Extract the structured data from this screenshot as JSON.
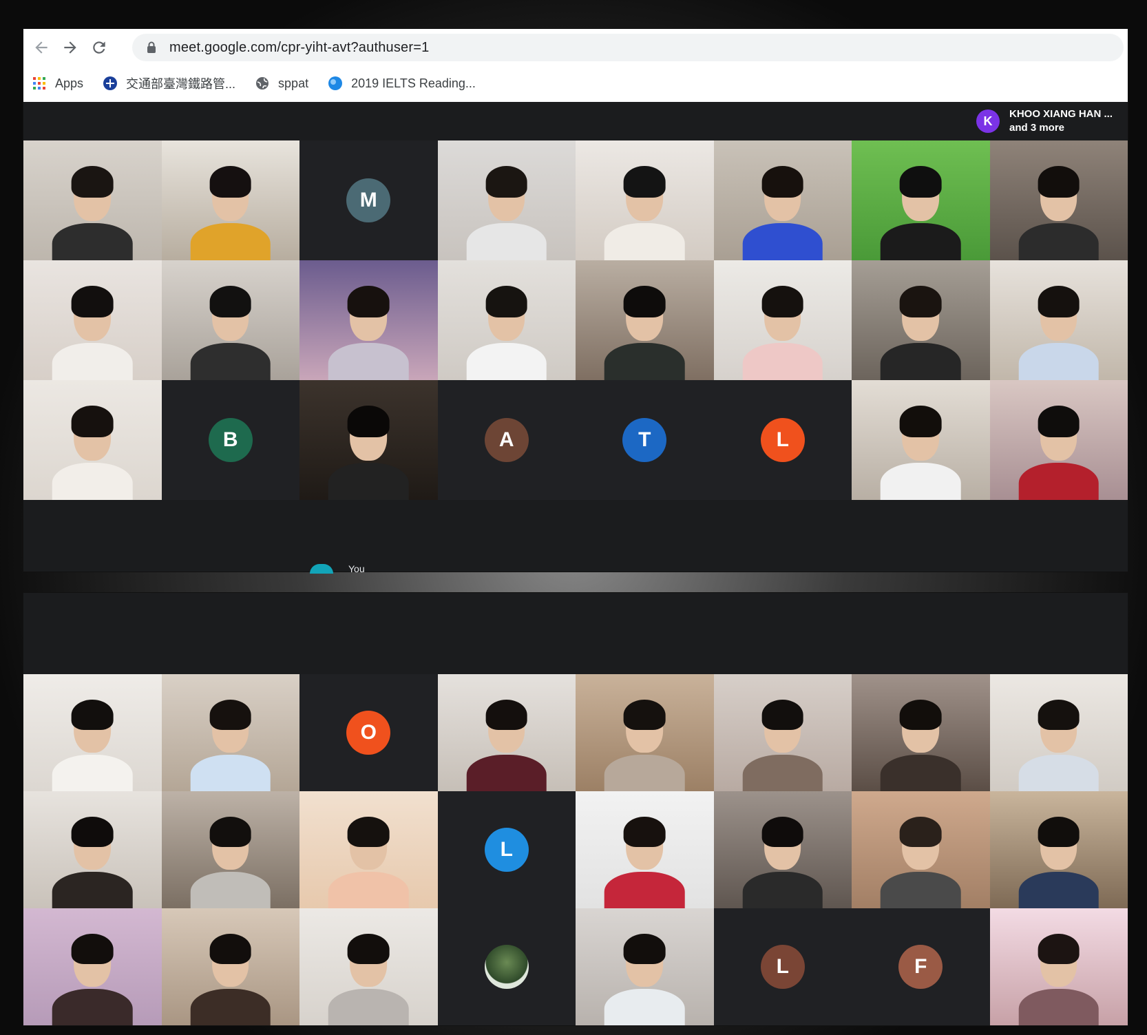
{
  "browser": {
    "url": "meet.google.com/cpr-yiht-avt?authuser=1",
    "bookmarks": [
      {
        "label": "Apps",
        "icon": "apps-grid-icon"
      },
      {
        "label": "交通部臺灣鐵路管...",
        "icon": "railway-logo-icon"
      },
      {
        "label": "sppat",
        "icon": "globe-icon"
      },
      {
        "label": "2019 IELTS Reading...",
        "icon": "ielts-logo-icon"
      }
    ]
  },
  "presenter": {
    "initial": "K",
    "name": "KHOO XIANG HAN ...",
    "more": "and 3 more",
    "color": "#7b33e6"
  },
  "self_label": "You",
  "top_grid": [
    {
      "type": "video",
      "bg": "#d8d3cc",
      "bg2": "#bdb6ad",
      "shirt": "#2d2d2d",
      "hair": "#1a1512"
    },
    {
      "type": "video",
      "bg": "#e8e4dd",
      "bg2": "#b7ad9f",
      "shirt": "#e0a32a",
      "hair": "#151010"
    },
    {
      "type": "avatar",
      "initial": "M",
      "color": "#4b6a74"
    },
    {
      "type": "video",
      "bg": "#dcdad8",
      "bg2": "#c8c3be",
      "shirt": "#e6e6e6",
      "hair": "#1b1612"
    },
    {
      "type": "video",
      "bg": "#ece8e4",
      "bg2": "#d3cbc3",
      "shirt": "#f0ece6",
      "hair": "#141414"
    },
    {
      "type": "video",
      "bg": "#c9c2b8",
      "bg2": "#a99f93",
      "shirt": "#2f4fd0",
      "hair": "#17110d"
    },
    {
      "type": "video",
      "bg": "#6fbf52",
      "bg2": "#4a9a38",
      "shirt": "#1b1b1b",
      "hair": "#0f0f0f"
    },
    {
      "type": "video",
      "bg": "#8f8379",
      "bg2": "#5b524b",
      "shirt": "#2c2c2c",
      "hair": "#120e0c"
    },
    {
      "type": "video",
      "bg": "#e9e4e0",
      "bg2": "#d7cfc8",
      "shirt": "#f1eeea",
      "hair": "#120f0e"
    },
    {
      "type": "video",
      "bg": "#d7d2cc",
      "bg2": "#a9a29a",
      "shirt": "#2e2e2e",
      "hair": "#121110"
    },
    {
      "type": "video",
      "bg": "#6b5c8e",
      "bg2": "#c9a6b9",
      "shirt": "#c7c1cf",
      "hair": "#17110e"
    },
    {
      "type": "video",
      "bg": "#e3e0dc",
      "bg2": "#cfcac4",
      "shirt": "#f3f3f3",
      "hair": "#161310"
    },
    {
      "type": "video",
      "bg": "#b9aea2",
      "bg2": "#7f6f62",
      "shirt": "#2a2f2c",
      "hair": "#0e0c0b"
    },
    {
      "type": "video",
      "bg": "#eceae6",
      "bg2": "#d6d1cc",
      "shirt": "#eec8c6",
      "hair": "#15110e"
    },
    {
      "type": "video",
      "bg": "#a59e95",
      "bg2": "#6c645c",
      "shirt": "#262626",
      "hair": "#1a1410"
    },
    {
      "type": "video",
      "bg": "#e7e2dc",
      "bg2": "#c1b7aa",
      "shirt": "#c9d7ea",
      "hair": "#15110e"
    },
    {
      "type": "video",
      "bg": "#ece8e3",
      "bg2": "#dcd6cf",
      "shirt": "#f2eee9",
      "hair": "#16110e"
    },
    {
      "type": "avatar",
      "initial": "B",
      "color": "#1e6a4e"
    },
    {
      "type": "video",
      "bg": "#3c332c",
      "bg2": "#1f1a16",
      "shirt": "#222",
      "hair": "#0a0807"
    },
    {
      "type": "avatar",
      "initial": "A",
      "color": "#6d4535"
    },
    {
      "type": "avatar",
      "initial": "T",
      "color": "#1c68c4"
    },
    {
      "type": "avatar",
      "initial": "L",
      "color": "#f0511d"
    },
    {
      "type": "video",
      "bg": "#e3ddd5",
      "bg2": "#b8afa4",
      "shirt": "#f1f1f1",
      "hair": "#120e0b"
    },
    {
      "type": "video",
      "bg": "#d9c7c3",
      "bg2": "#a88f93",
      "shirt": "#b4202c",
      "hair": "#0f0d0c"
    }
  ],
  "bottom_grid": [
    {
      "type": "video",
      "bg": "#efece8",
      "bg2": "#dcd7d1",
      "shirt": "#f4f2ee",
      "hair": "#120f0d"
    },
    {
      "type": "video",
      "bg": "#d9d0c6",
      "bg2": "#b4a696",
      "shirt": "#cfe0f2",
      "hair": "#16110e"
    },
    {
      "type": "avatar",
      "initial": "O",
      "color": "#f0511d"
    },
    {
      "type": "video",
      "bg": "#e5e1dd",
      "bg2": "#c6bfb7",
      "shirt": "#5a1e28",
      "hair": "#140f0d"
    },
    {
      "type": "video",
      "bg": "#c9b29a",
      "bg2": "#9c8065",
      "shirt": "#b7a89a",
      "hair": "#15110e"
    },
    {
      "type": "video",
      "bg": "#d7cfc9",
      "bg2": "#b8aaa2",
      "shirt": "#7f6c60",
      "hair": "#120f0d"
    },
    {
      "type": "video",
      "bg": "#a0928a",
      "bg2": "#5b4e46",
      "shirt": "#3a302b",
      "hair": "#120e0b"
    },
    {
      "type": "video",
      "bg": "#ece8e3",
      "bg2": "#d1cbc4",
      "shirt": "#d6dde6",
      "hair": "#15110e"
    },
    {
      "type": "video",
      "bg": "#e7e3de",
      "bg2": "#c9c2ba",
      "shirt": "#2b2522",
      "hair": "#0f0c0b"
    },
    {
      "type": "video",
      "bg": "#bdb2a7",
      "bg2": "#7b6f63",
      "shirt": "#c0bdb8",
      "hair": "#120f0d"
    },
    {
      "type": "video",
      "bg": "#f1e0cf",
      "bg2": "#e7c9ad",
      "shirt": "#f0c2a8",
      "hair": "#15110e"
    },
    {
      "type": "avatar",
      "initial": "L",
      "color": "#1f8ee0"
    },
    {
      "type": "video",
      "bg": "#f2f2f2",
      "bg2": "#e2e2e2",
      "shirt": "#c5263a",
      "hair": "#17110e"
    },
    {
      "type": "video",
      "bg": "#9c928b",
      "bg2": "#5f5650",
      "shirt": "#2a2a2a",
      "hair": "#0f0c0b"
    },
    {
      "type": "video",
      "bg": "#cfa98d",
      "bg2": "#a27f65",
      "shirt": "#4a4a4a",
      "hair": "#2a211b"
    },
    {
      "type": "video",
      "bg": "#c9b59c",
      "bg2": "#7e6a55",
      "shirt": "#2a3a5a",
      "hair": "#110e0c"
    },
    {
      "type": "video",
      "bg": "#d3b8d1",
      "bg2": "#b69bb8",
      "shirt": "#3a2a2a",
      "hair": "#120e0c"
    },
    {
      "type": "video",
      "bg": "#d7c8b8",
      "bg2": "#a99683",
      "shirt": "#3c2d26",
      "hair": "#120e0c"
    },
    {
      "type": "video",
      "bg": "#ece9e5",
      "bg2": "#d7d2cc",
      "shirt": "#b9b4b0",
      "hair": "#120e0c"
    },
    {
      "type": "avatar",
      "initial": "",
      "color": "#dfe7dc",
      "photo": true
    },
    {
      "type": "video",
      "bg": "#d9d5d2",
      "bg2": "#b8b2ad",
      "shirt": "#e8ecef",
      "hair": "#120e0c"
    },
    {
      "type": "avatar",
      "initial": "L",
      "color": "#7a4535"
    },
    {
      "type": "avatar",
      "initial": "F",
      "color": "#9a5a45"
    },
    {
      "type": "video",
      "bg": "#f3dbe4",
      "bg2": "#c7a1a7",
      "shirt": "#7f5a5f",
      "hair": "#1c1412"
    }
  ]
}
